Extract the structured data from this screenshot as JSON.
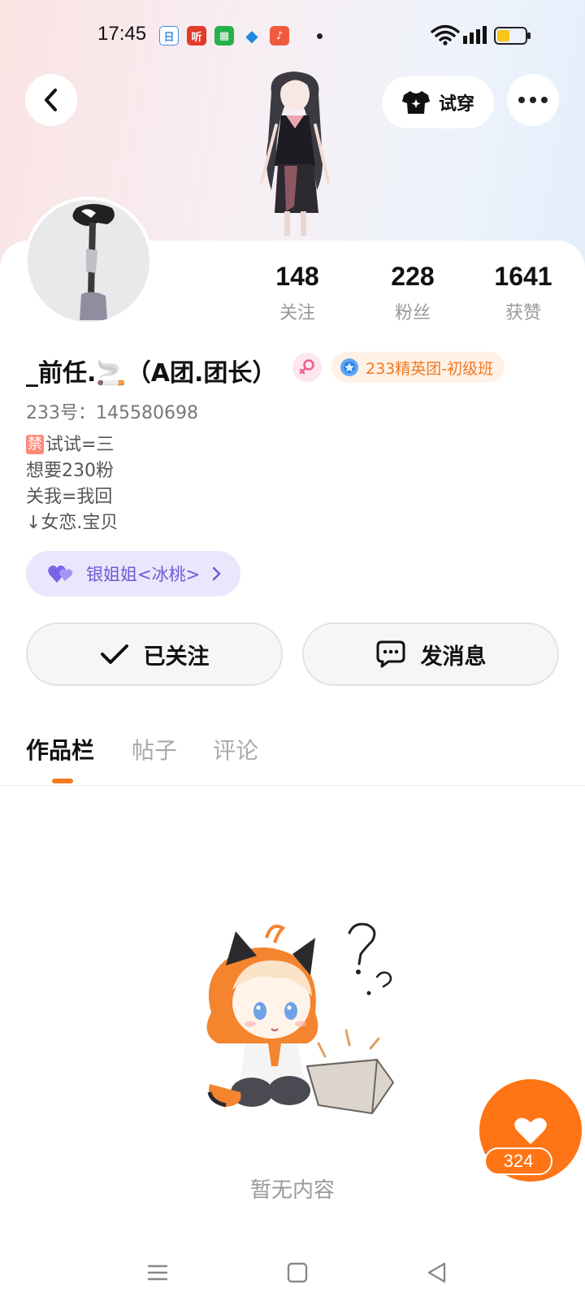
{
  "status_bar": {
    "time": "17:45",
    "app_icons": [
      {
        "name": "calendar-app-icon",
        "glyph": "日",
        "color": "#2d8cf0"
      },
      {
        "name": "listen-app-icon",
        "glyph": "听",
        "color": "#e23b2a"
      },
      {
        "name": "store-app-icon",
        "glyph": "▦",
        "color": "#27b14a"
      },
      {
        "name": "feather-app-icon",
        "glyph": "◆",
        "color": "#1e88e5"
      },
      {
        "name": "music-app-icon",
        "glyph": "♪",
        "color": "#ef5a3c"
      }
    ]
  },
  "header": {
    "try_on_label": "试穿"
  },
  "stats": [
    {
      "value": "148",
      "label": "关注"
    },
    {
      "value": "228",
      "label": "粉丝"
    },
    {
      "value": "1641",
      "label": "获赞"
    }
  ],
  "profile": {
    "name": "_前任.🚬（A团.团长）",
    "league_badge": "233精英团-初级班",
    "uid": "233号：145580698",
    "bio": {
      "ban_tag": "禁",
      "lines": [
        "试试=三",
        "想要230粉",
        "关我=我回",
        "↓女恋.宝贝"
      ]
    },
    "cp_link": "银姐姐<冰桃>"
  },
  "actions": {
    "followed_label": "已关注",
    "message_label": "发消息"
  },
  "tabs": [
    {
      "label": "作品栏",
      "active": true
    },
    {
      "label": "帖子",
      "active": false
    },
    {
      "label": "评论",
      "active": false
    }
  ],
  "empty_state": {
    "text": "暂无内容"
  },
  "like_fab": {
    "count": "324"
  },
  "colors": {
    "accent": "#ff7414",
    "league_text": "#f07a22",
    "cp_text": "#6b5bd6"
  }
}
